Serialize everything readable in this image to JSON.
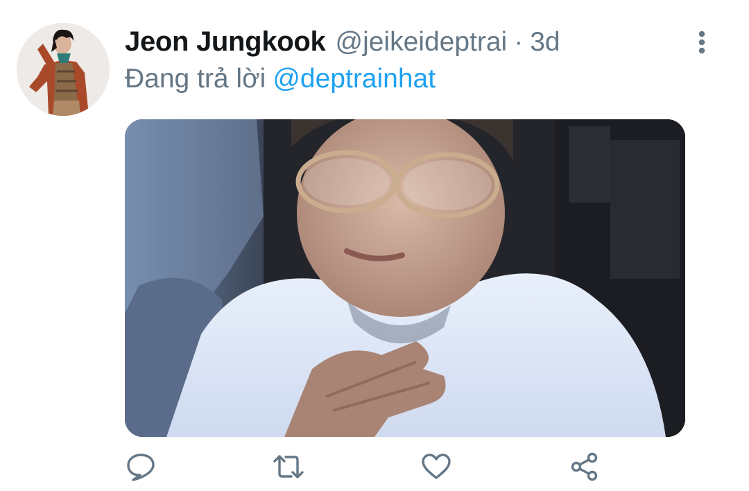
{
  "tweet": {
    "display_name": "Jeon Jungkook",
    "handle": "@jeikeideptrai",
    "separator": "·",
    "time": "3d",
    "reply_prefix": "Đang trả lời",
    "reply_to": "@deptrainhat"
  },
  "icons": {
    "more": "more-vertical-icon",
    "reply": "reply-icon",
    "retweet": "retweet-icon",
    "like": "heart-icon",
    "share": "share-icon"
  },
  "colors": {
    "name": "#14171a",
    "secondary": "#657786",
    "link": "#1da1f2",
    "icon": "#657786"
  }
}
